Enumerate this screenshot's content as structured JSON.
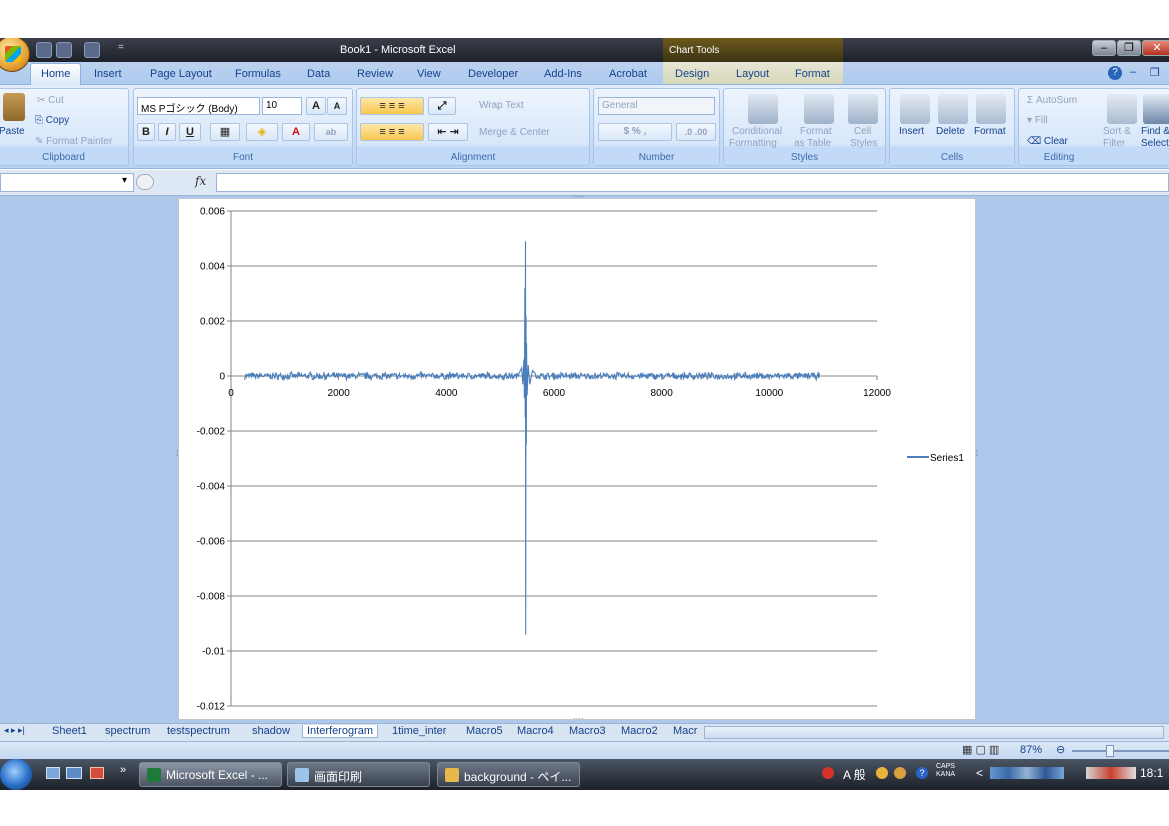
{
  "window": {
    "title": "Book1 - Microsoft Excel",
    "contextual_tab_group": "Chart Tools"
  },
  "ribbon_tabs": [
    "Home",
    "Insert",
    "Page Layout",
    "Formulas",
    "Data",
    "Review",
    "View",
    "Developer",
    "Add-Ins",
    "Acrobat",
    "Design",
    "Layout",
    "Format"
  ],
  "ribbon": {
    "clipboard": {
      "paste": "Paste",
      "cut": "Cut",
      "copy": "Copy",
      "format_painter": "Format Painter",
      "label": "Clipboard"
    },
    "font": {
      "font_name": "MS Pゴシック (Body)",
      "font_size": "10",
      "bold": "B",
      "italic": "I",
      "underline": "U",
      "label": "Font"
    },
    "alignment": {
      "wrap_text": "Wrap Text",
      "merge_center": "Merge & Center",
      "label": "Alignment"
    },
    "number": {
      "format": "General",
      "label": "Number"
    },
    "styles": {
      "conditional_1": "Conditional",
      "conditional_2": "Formatting",
      "format_table_1": "Format",
      "format_table_2": "as Table",
      "cell_styles_1": "Cell",
      "cell_styles_2": "Styles",
      "label": "Styles"
    },
    "cells": {
      "insert": "Insert",
      "delete": "Delete",
      "format": "Format",
      "label": "Cells"
    },
    "editing": {
      "autosum": "AutoSum",
      "fill": "Fill",
      "clear": "Clear",
      "sort_1": "Sort &",
      "sort_2": "Filter",
      "find_1": "Find &",
      "find_2": "Select",
      "label": "Editing"
    }
  },
  "formula_bar": {
    "fx": "fx",
    "name_box": "",
    "formula": ""
  },
  "chart_data": {
    "type": "line",
    "title": "",
    "xlabel": "",
    "ylabel": "",
    "xlim": [
      0,
      12000
    ],
    "ylim": [
      -0.012,
      0.006
    ],
    "x_ticks": [
      "0",
      "2000",
      "4000",
      "6000",
      "8000",
      "10000",
      "12000"
    ],
    "y_ticks": [
      "0.006",
      "0.004",
      "0.002",
      "0",
      "-0.002",
      "-0.004",
      "-0.006",
      "-0.008",
      "-0.01",
      "-0.012"
    ],
    "gridlines": "horizontal",
    "legend_position": "right",
    "line_color": "#4a7ebb",
    "series": [
      {
        "name": "Series1",
        "noise_range": [
          250,
          10950
        ],
        "noise_amplitude": 0.00015,
        "x": [
          5350,
          5400,
          5420,
          5440,
          5450,
          5460,
          5465,
          5470,
          5475,
          5480,
          5485,
          5490,
          5500,
          5520,
          5550,
          5600,
          5650
        ],
        "y": [
          0.0001,
          0.0003,
          -0.0003,
          0.0006,
          -0.0008,
          0.0032,
          -0.0015,
          0.0049,
          -0.0094,
          0.0022,
          -0.0025,
          0.0012,
          -0.0007,
          0.0004,
          -0.0003,
          0.0002,
          0.0001
        ]
      }
    ]
  },
  "sheet_tabs": [
    "Sheet1",
    "spectrum",
    "testspectrum",
    "shadow",
    "Interferogram",
    "1time_inter",
    "Macro5",
    "Macro4",
    "Macro3",
    "Macro2",
    "Macr"
  ],
  "status": {
    "zoom": "87%"
  },
  "taskbar": {
    "items": [
      "Microsoft Excel - ...",
      "画面印刷",
      "background - ペイ..."
    ],
    "tray_ime": "A 般",
    "caps": "CAPS",
    "kana": "KANA",
    "clock": "18:1"
  }
}
